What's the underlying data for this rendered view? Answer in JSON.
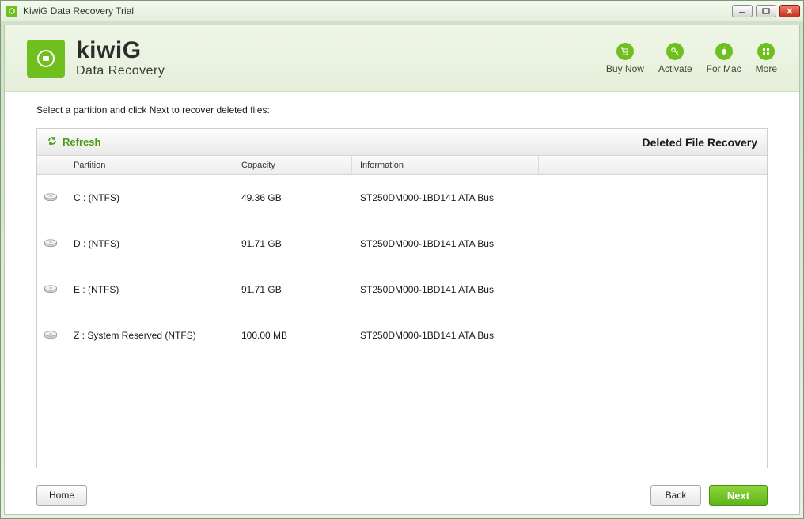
{
  "window": {
    "title": "KiwiG Data Recovery Trial"
  },
  "brand": {
    "name": "kiwiG",
    "subtitle": "Data Recovery"
  },
  "header_actions": {
    "buy": {
      "label": "Buy Now"
    },
    "activate": {
      "label": "Activate"
    },
    "mac": {
      "label": "For Mac"
    },
    "more": {
      "label": "More"
    }
  },
  "instruction": "Select a partition and click Next to recover deleted files:",
  "panel": {
    "refresh_label": "Refresh",
    "title": "Deleted File Recovery",
    "columns": {
      "partition": "Partition",
      "capacity": "Capacity",
      "information": "Information"
    }
  },
  "partitions": [
    {
      "label": "C :  (NTFS)",
      "capacity": "49.36 GB",
      "info": "ST250DM000-1BD141  ATA Bus"
    },
    {
      "label": "D :  (NTFS)",
      "capacity": "91.71 GB",
      "info": "ST250DM000-1BD141  ATA Bus"
    },
    {
      "label": "E :  (NTFS)",
      "capacity": "91.71 GB",
      "info": "ST250DM000-1BD141  ATA Bus"
    },
    {
      "label": "Z : System Reserved  (NTFS)",
      "capacity": "100.00 MB",
      "info": "ST250DM000-1BD141  ATA Bus"
    }
  ],
  "buttons": {
    "home": "Home",
    "back": "Back",
    "next": "Next"
  }
}
